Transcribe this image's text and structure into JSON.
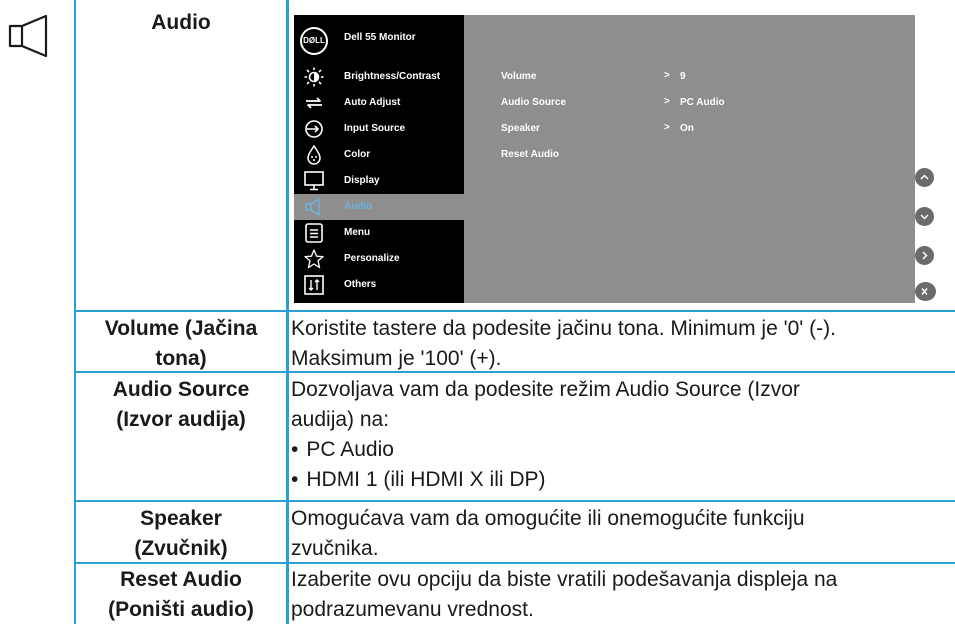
{
  "header": {
    "title": "Audio"
  },
  "osd": {
    "logo": "DØLL",
    "model": "Dell 55 Monitor",
    "menu": [
      {
        "label": "Brightness/Contrast",
        "icon": "brightness-icon"
      },
      {
        "label": "Auto Adjust",
        "icon": "auto-adjust-icon"
      },
      {
        "label": "Input Source",
        "icon": "input-source-icon"
      },
      {
        "label": "Color",
        "icon": "color-icon"
      },
      {
        "label": "Display",
        "icon": "display-icon"
      },
      {
        "label": "Audio",
        "icon": "speaker-icon"
      },
      {
        "label": "Menu",
        "icon": "menu-icon"
      },
      {
        "label": "Personalize",
        "icon": "star-icon"
      },
      {
        "label": "Others",
        "icon": "others-icon"
      }
    ],
    "settings": [
      {
        "label": "Volume",
        "value": "9"
      },
      {
        "label": "Audio Source",
        "value": "PC Audio"
      },
      {
        "label": "Speaker",
        "value": "On"
      },
      {
        "label": "Reset Audio",
        "value": ""
      }
    ],
    "arrow": ">",
    "buttons": [
      "up-button",
      "down-button",
      "enter-button",
      "exit-button"
    ],
    "colors": {
      "accent": "#2a9fd6",
      "panel": "#8e8e8e",
      "selected_text": "#6fb3e0"
    }
  },
  "rows": [
    {
      "label_lines": [
        "Volume (Jačina",
        "tona)"
      ],
      "desc_lines": [
        "Koristite tastere da podesite jačinu tona. Minimum je '0' (-).",
        "Maksimum je '100' (+)."
      ]
    },
    {
      "label_lines": [
        "Audio Source",
        "(Izvor audija)"
      ],
      "desc_lines": [
        "Dozvoljava vam da podesite režim Audio Source (Izvor",
        "audija) na:"
      ],
      "bullets": [
        "PC Audio",
        "HDMI 1 (ili HDMI X ili DP)"
      ]
    },
    {
      "label_lines": [
        "Speaker",
        "(Zvučnik)"
      ],
      "desc_lines": [
        "Omogućava vam da omogućite ili onemogućite funkciju",
        "zvučnika."
      ]
    },
    {
      "label_lines": [
        "Reset Audio",
        "(Poništi audio)"
      ],
      "desc_lines": [
        "Izaberite ovu opciju da biste vratili podešavanja displeja na",
        "podrazumevanu vrednost."
      ]
    }
  ]
}
